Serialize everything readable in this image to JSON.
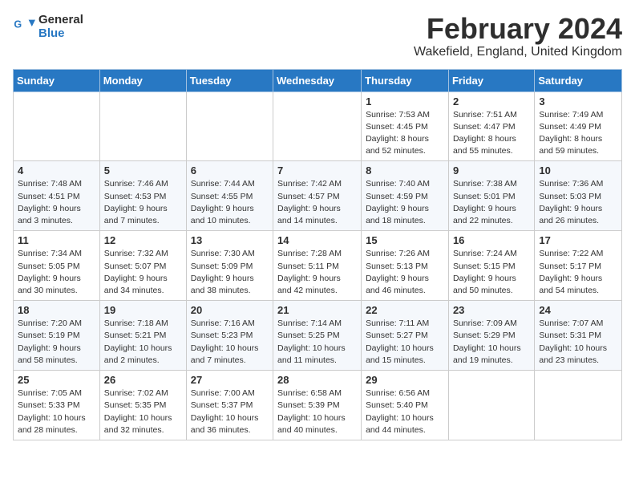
{
  "logo": {
    "line1": "General",
    "line2": "Blue"
  },
  "header": {
    "month": "February 2024",
    "location": "Wakefield, England, United Kingdom"
  },
  "weekdays": [
    "Sunday",
    "Monday",
    "Tuesday",
    "Wednesday",
    "Thursday",
    "Friday",
    "Saturday"
  ],
  "weeks": [
    [
      {
        "day": "",
        "info": ""
      },
      {
        "day": "",
        "info": ""
      },
      {
        "day": "",
        "info": ""
      },
      {
        "day": "",
        "info": ""
      },
      {
        "day": "1",
        "info": "Sunrise: 7:53 AM\nSunset: 4:45 PM\nDaylight: 8 hours\nand 52 minutes."
      },
      {
        "day": "2",
        "info": "Sunrise: 7:51 AM\nSunset: 4:47 PM\nDaylight: 8 hours\nand 55 minutes."
      },
      {
        "day": "3",
        "info": "Sunrise: 7:49 AM\nSunset: 4:49 PM\nDaylight: 8 hours\nand 59 minutes."
      }
    ],
    [
      {
        "day": "4",
        "info": "Sunrise: 7:48 AM\nSunset: 4:51 PM\nDaylight: 9 hours\nand 3 minutes."
      },
      {
        "day": "5",
        "info": "Sunrise: 7:46 AM\nSunset: 4:53 PM\nDaylight: 9 hours\nand 7 minutes."
      },
      {
        "day": "6",
        "info": "Sunrise: 7:44 AM\nSunset: 4:55 PM\nDaylight: 9 hours\nand 10 minutes."
      },
      {
        "day": "7",
        "info": "Sunrise: 7:42 AM\nSunset: 4:57 PM\nDaylight: 9 hours\nand 14 minutes."
      },
      {
        "day": "8",
        "info": "Sunrise: 7:40 AM\nSunset: 4:59 PM\nDaylight: 9 hours\nand 18 minutes."
      },
      {
        "day": "9",
        "info": "Sunrise: 7:38 AM\nSunset: 5:01 PM\nDaylight: 9 hours\nand 22 minutes."
      },
      {
        "day": "10",
        "info": "Sunrise: 7:36 AM\nSunset: 5:03 PM\nDaylight: 9 hours\nand 26 minutes."
      }
    ],
    [
      {
        "day": "11",
        "info": "Sunrise: 7:34 AM\nSunset: 5:05 PM\nDaylight: 9 hours\nand 30 minutes."
      },
      {
        "day": "12",
        "info": "Sunrise: 7:32 AM\nSunset: 5:07 PM\nDaylight: 9 hours\nand 34 minutes."
      },
      {
        "day": "13",
        "info": "Sunrise: 7:30 AM\nSunset: 5:09 PM\nDaylight: 9 hours\nand 38 minutes."
      },
      {
        "day": "14",
        "info": "Sunrise: 7:28 AM\nSunset: 5:11 PM\nDaylight: 9 hours\nand 42 minutes."
      },
      {
        "day": "15",
        "info": "Sunrise: 7:26 AM\nSunset: 5:13 PM\nDaylight: 9 hours\nand 46 minutes."
      },
      {
        "day": "16",
        "info": "Sunrise: 7:24 AM\nSunset: 5:15 PM\nDaylight: 9 hours\nand 50 minutes."
      },
      {
        "day": "17",
        "info": "Sunrise: 7:22 AM\nSunset: 5:17 PM\nDaylight: 9 hours\nand 54 minutes."
      }
    ],
    [
      {
        "day": "18",
        "info": "Sunrise: 7:20 AM\nSunset: 5:19 PM\nDaylight: 9 hours\nand 58 minutes."
      },
      {
        "day": "19",
        "info": "Sunrise: 7:18 AM\nSunset: 5:21 PM\nDaylight: 10 hours\nand 2 minutes."
      },
      {
        "day": "20",
        "info": "Sunrise: 7:16 AM\nSunset: 5:23 PM\nDaylight: 10 hours\nand 7 minutes."
      },
      {
        "day": "21",
        "info": "Sunrise: 7:14 AM\nSunset: 5:25 PM\nDaylight: 10 hours\nand 11 minutes."
      },
      {
        "day": "22",
        "info": "Sunrise: 7:11 AM\nSunset: 5:27 PM\nDaylight: 10 hours\nand 15 minutes."
      },
      {
        "day": "23",
        "info": "Sunrise: 7:09 AM\nSunset: 5:29 PM\nDaylight: 10 hours\nand 19 minutes."
      },
      {
        "day": "24",
        "info": "Sunrise: 7:07 AM\nSunset: 5:31 PM\nDaylight: 10 hours\nand 23 minutes."
      }
    ],
    [
      {
        "day": "25",
        "info": "Sunrise: 7:05 AM\nSunset: 5:33 PM\nDaylight: 10 hours\nand 28 minutes."
      },
      {
        "day": "26",
        "info": "Sunrise: 7:02 AM\nSunset: 5:35 PM\nDaylight: 10 hours\nand 32 minutes."
      },
      {
        "day": "27",
        "info": "Sunrise: 7:00 AM\nSunset: 5:37 PM\nDaylight: 10 hours\nand 36 minutes."
      },
      {
        "day": "28",
        "info": "Sunrise: 6:58 AM\nSunset: 5:39 PM\nDaylight: 10 hours\nand 40 minutes."
      },
      {
        "day": "29",
        "info": "Sunrise: 6:56 AM\nSunset: 5:40 PM\nDaylight: 10 hours\nand 44 minutes."
      },
      {
        "day": "",
        "info": ""
      },
      {
        "day": "",
        "info": ""
      }
    ]
  ]
}
